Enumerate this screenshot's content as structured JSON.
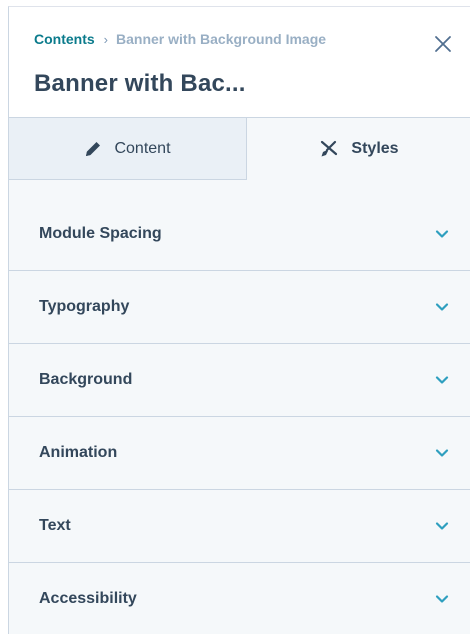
{
  "breadcrumb": {
    "root": "Contents",
    "separator": "›",
    "current": "Banner with Background Image"
  },
  "header": {
    "title": "Banner with Bac..."
  },
  "tabs": [
    {
      "label": "Content",
      "icon": "pencil-icon",
      "active": false
    },
    {
      "label": "Styles",
      "icon": "brush-icon",
      "active": true
    }
  ],
  "sections": [
    {
      "label": "Module Spacing"
    },
    {
      "label": "Typography"
    },
    {
      "label": "Background"
    },
    {
      "label": "Animation"
    },
    {
      "label": "Text"
    },
    {
      "label": "Accessibility"
    }
  ],
  "colors": {
    "accent": "#0b7b8c",
    "chevron": "#2e9fbf",
    "text": "#33475b",
    "border": "#cbd6e2",
    "panel_bg": "#f5f8fa",
    "tab_inactive_bg": "#eaf0f6"
  }
}
